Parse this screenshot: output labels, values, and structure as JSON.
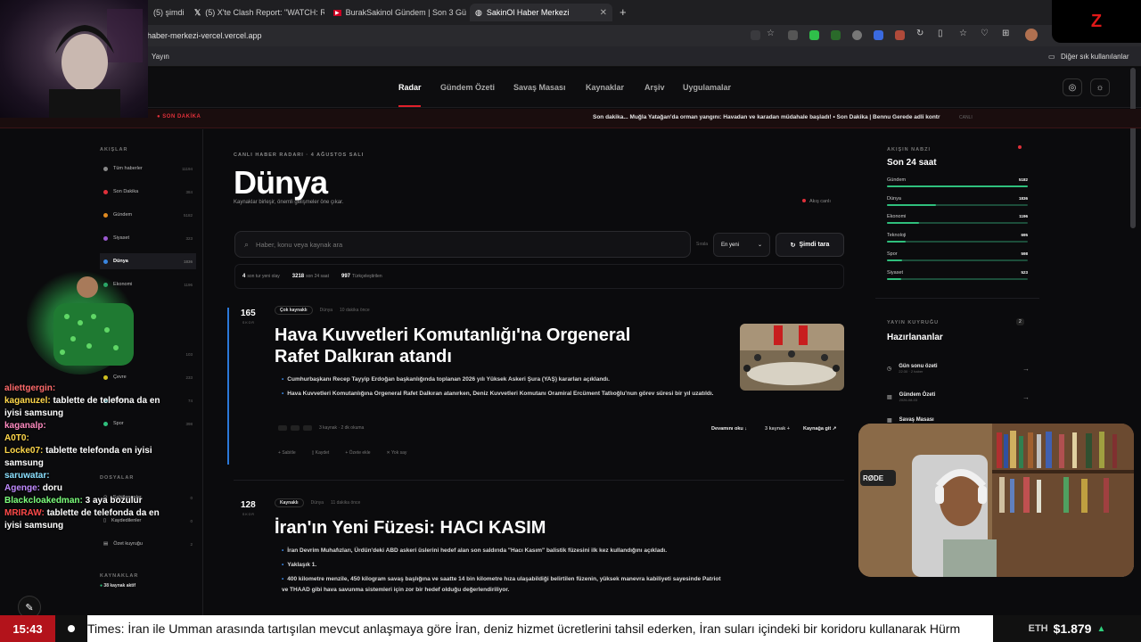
{
  "browser": {
    "tabs": [
      {
        "label": "(5) şimdi"
      },
      {
        "label": "(5) X'te Clash Report: \"WATCH: Ru"
      },
      {
        "label": "BurakSakinol Gündem | Son 3 Gün"
      },
      {
        "label": "SakinOl Haber Merkezi",
        "active": true
      }
    ],
    "url": "haber-merkezi-vercel.vercel.app",
    "bookmark_left": "Yayın",
    "bookmark_right": "Diğer sık kullanılanlar"
  },
  "nav": {
    "items": [
      "Radar",
      "Gündem Özeti",
      "Savaş Masası",
      "Kaynaklar",
      "Arşiv",
      "Uygulamalar"
    ],
    "active": "Radar"
  },
  "breaking": {
    "label": "SON DAKİKA",
    "text": "Son dakika... Muğla Yatağan'da orman yangını: Havadan ve karadan müdahale başladı! • Son Dakika | Bennu Gerede adli kontr",
    "live": "CANLI"
  },
  "sidebar": {
    "heading": "AKIŞLAR",
    "items": [
      {
        "label": "Tüm haberler",
        "count": "11194",
        "color": "#888888"
      },
      {
        "label": "Son Dakika",
        "count": "384",
        "color": "#e0303a"
      },
      {
        "label": "Gündem",
        "count": "5182",
        "color": "#e08a20"
      },
      {
        "label": "Siyaset",
        "count": "323",
        "color": "#9b59d0"
      },
      {
        "label": "Dünya",
        "count": "1836",
        "color": "#3a86e0",
        "active": true
      },
      {
        "label": "Ekonomi",
        "count": "1196",
        "color": "#2fbf7c"
      },
      {
        "label": "Sağlık",
        "count": "103",
        "color": "#e04a7a"
      },
      {
        "label": "Çevre",
        "count": "233",
        "color": "#d0c020"
      },
      {
        "label": "Eğitim",
        "count": "74",
        "color": "#20b0c0"
      },
      {
        "label": "Spor",
        "count": "398",
        "color": "#2fbf7c"
      }
    ],
    "section2": "DOSYALAR",
    "saved": [
      {
        "label": "Sabitlenenler",
        "count": "0"
      },
      {
        "label": "Kaydedilenler",
        "count": "0"
      },
      {
        "label": "Özet kuyruğu",
        "count": "2"
      }
    ],
    "sources_heading": "KAYNAKLAR",
    "sources_active": "38 kaynak aktif"
  },
  "main": {
    "kicker": "CANLI HABER RADARI · 4 AĞUSTOS SALI",
    "title": "Dünya",
    "subtitle": "Kaynaklar birleşir, önemli gelişmeler öne çıkar.",
    "live_label": "Akış canlı",
    "search_placeholder": "Haber, konu veya kaynak ara",
    "sort_label": "Sırala",
    "sort_value": "En yeni",
    "scan_button": "Şimdi tara",
    "stats": [
      {
        "value": "4",
        "label": "son tur yeni olay"
      },
      {
        "value": "3218",
        "label": "son 24 saat"
      },
      {
        "value": "997",
        "label": "Türkçeleştirilen"
      }
    ]
  },
  "stories": [
    {
      "score": "165",
      "score_label": "SKOR",
      "badge": "Çok kaynaklı",
      "category": "Dünya",
      "time": "10 dakika önce",
      "headline_line1": "Hava Kuvvetleri Komutanlığı'na Orgeneral",
      "headline_line2": "Rafet Dalkıran atandı",
      "bullets": [
        "Cumhurbaşkanı Recep Tayyip Erdoğan başkanlığında toplanan 2026 yılı Yüksek Askeri Şura (YAŞ) kararları açıklandı.",
        "Hava Kuvvetleri Komutanlığına Orgeneral Rafet Dalkıran atanırken, Deniz Kuvvetleri Komutanı Oramiral Ercüment Tatlıoğlu'nun görev süresi bir yıl uzatıldı."
      ],
      "sources_meta": "3 kaynak · 2 dk okuma",
      "read_more": "Devamını oku ↓",
      "sources_link": "3 kaynak +",
      "go_source": "Kaynağa git ↗",
      "actions": [
        "Sabitle",
        "Kaydet",
        "Özete ekle",
        "Yok say"
      ]
    },
    {
      "score": "128",
      "score_label": "SKOR",
      "badge": "Kaynaklı",
      "category": "Dünya",
      "time": "11 dakika önce",
      "headline_line1": "İran'ın Yeni Füzesi: HACI KASIM",
      "bullets": [
        "İran Devrim Muhafızları, Ürdün'deki ABD askeri üslerini hedef alan son saldırıda \"Hacı Kasım\" balistik füzesini ilk kez kullandığını açıkladı.",
        "Yaklaşık 1.",
        "400 kilometre menzile, 450 kilogram savaş başlığına ve saatte 14 bin kilometre hıza ulaşabildiği belirtilen füzenin, yüksek manevra kabiliyeti sayesinde Patriot ve THAAD gibi hava savunma sistemleri için zor bir hedef olduğu değerlendiriliyor."
      ]
    }
  ],
  "right_panel": {
    "pulse_heading": "AKIŞIN NABZI",
    "pulse_title": "Son 24 saat",
    "pulse": [
      {
        "label": "Gündem",
        "value": "5182",
        "fraction": 1.0
      },
      {
        "label": "Dünya",
        "value": "1836",
        "fraction": 0.35
      },
      {
        "label": "Ekonomi",
        "value": "1196",
        "fraction": 0.23
      },
      {
        "label": "Teknoloji",
        "value": "695",
        "fraction": 0.13
      },
      {
        "label": "Spor",
        "value": "598",
        "fraction": 0.11
      },
      {
        "label": "Siyaset",
        "value": "523",
        "fraction": 0.1
      }
    ],
    "queue_heading": "YAYIN KUYRUĞU",
    "queue_count": "2",
    "queue_title": "Hazırlananlar",
    "queue": [
      {
        "label": "Gün sonu özeti",
        "sub": "22:30 · 2 haber"
      },
      {
        "label": "Gündem Özeti",
        "sub": "2026-08-03"
      },
      {
        "label": "Savaş Masası",
        "sub": ""
      }
    ]
  },
  "stream": {
    "logo": "Z",
    "chat": [
      {
        "user": "aliettgergin:",
        "msg": "",
        "color": "#ff6b6b"
      },
      {
        "user": "kaganuzel:",
        "msg": "tablette de telefona da en iyisi samsung",
        "color": "#ffd84a"
      },
      {
        "user": "kaganalp:",
        "msg": "",
        "color": "#ff8ac0"
      },
      {
        "user": "A0T0:",
        "msg": "",
        "color": "#ffd84a"
      },
      {
        "user": "Locke07:",
        "msg": "tablette telefonda en iyisi samsung",
        "color": "#ffd84a"
      },
      {
        "user": "saruwatar:",
        "msg": "",
        "color": "#8ae0ff"
      },
      {
        "user": "Agenge:",
        "msg": "doru",
        "color": "#c08aff"
      },
      {
        "user": "Blackcloakedman:",
        "msg": "3 aya bozulur",
        "color": "#7cff7c"
      },
      {
        "user": "MRIRAW:",
        "msg": "tablette de telefonda da en iyisi samsung",
        "color": "#ff4a4a"
      }
    ],
    "clock": "15:43",
    "ticker": "Times: İran ile Umman arasında tartışılan mevcut anlaşmaya göre İran, deniz hizmet ücretlerini tahsil ederken, İran suları içindeki bir koridoru kullanarak Hürm",
    "eth_symbol": "ETH",
    "eth_price": "$1.879",
    "eth_arrow": "▲",
    "mic_label": "RØDE"
  }
}
